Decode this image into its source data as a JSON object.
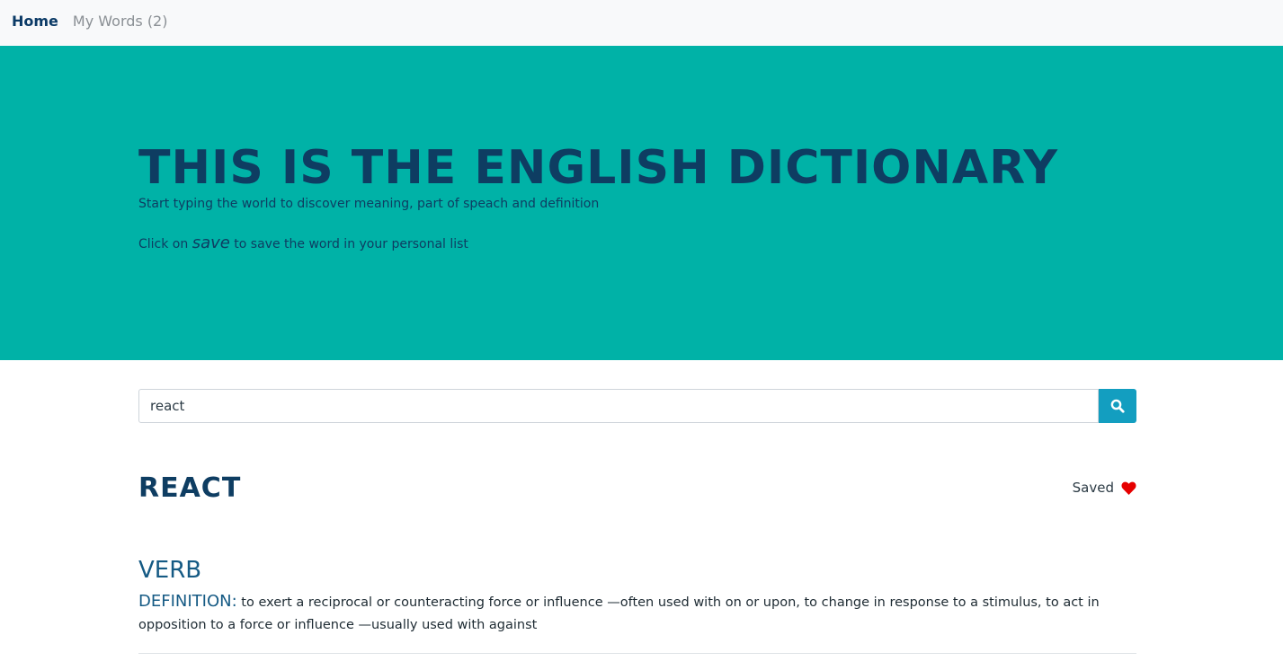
{
  "nav": {
    "home": "Home",
    "my_words": "My Words (2)"
  },
  "hero": {
    "title": "THIS IS THE ENGLISH DICTIONARY",
    "subtitle": "Start typing the world to discover meaning, part of speach and definition",
    "note_prefix": "Click on",
    "note_emphasis": "save",
    "note_suffix": "to save the word in your personal list"
  },
  "search": {
    "value": "react",
    "icon": "search-icon"
  },
  "result": {
    "word": "REACT",
    "saved_label": "Saved",
    "saved_icon": "heart-icon",
    "saved_color": "#e60000",
    "part_of_speech": "VERB",
    "definition_label": "DEFINITION:",
    "definition_text": "to exert a reciprocal or counteracting force or influence —often used with on or upon, to change in response to a stimulus, to act in opposition to a force or influence —usually used with against"
  },
  "colors": {
    "hero_bg": "#00b2a7",
    "title": "#0e3d62",
    "search_button": "#139ec0"
  }
}
